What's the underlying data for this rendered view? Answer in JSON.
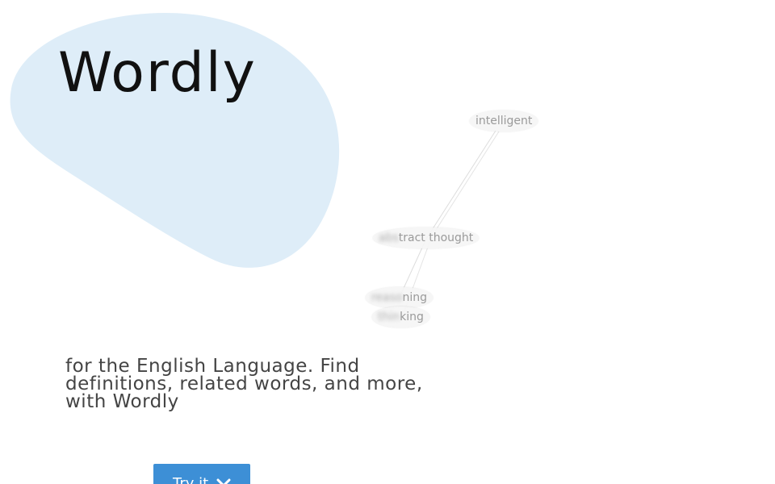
{
  "brand": {
    "title": "Wordly",
    "accent_color": "#deedf8"
  },
  "hero": {
    "tagline": "for the English Language. Find definitions, related words, and more, with Wordly"
  },
  "cta": {
    "label": "Try it",
    "icon": "chevron-down-icon",
    "color": "#3d8fd6"
  },
  "graph": {
    "nodes": [
      {
        "id": "intelligent",
        "label": "intelligent",
        "blurred_prefix": ""
      },
      {
        "id": "abstract",
        "label": "abstract thought",
        "blurred_prefix": "abs",
        "rest": "tract thought"
      },
      {
        "id": "reasoning",
        "label": "reasoning",
        "blurred_prefix": "reaso",
        "rest": "ning"
      },
      {
        "id": "thinking",
        "label": "thinking",
        "blurred_prefix": "thin",
        "rest": "king"
      }
    ]
  }
}
